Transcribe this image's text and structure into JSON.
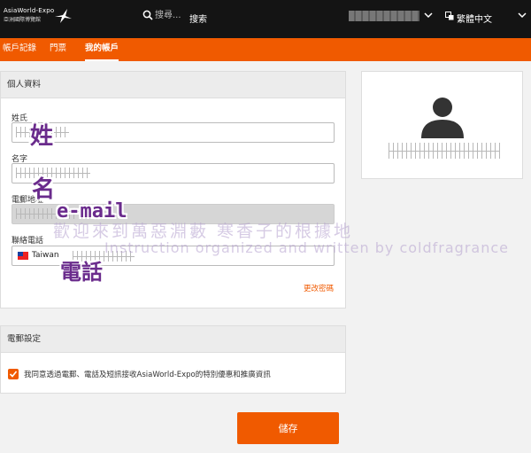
{
  "header": {
    "logo_line1": "AsiaWorld-Expo",
    "logo_line2": "亞洲國際博覽館",
    "search_placeholder": "搜尋...",
    "search_label": "搜索",
    "language_label": "繁體中文"
  },
  "tabs": [
    {
      "label": "帳戶記錄",
      "active": false
    },
    {
      "label": "門票",
      "active": false
    },
    {
      "label": "我的帳戶",
      "active": true
    }
  ],
  "personal": {
    "heading": "個人資料",
    "surname_label": "姓氏",
    "given_name_label": "名字",
    "email_label": "電郵地址",
    "phone_label": "聯絡電話",
    "phone_country": "Taiwan",
    "change_password": "更改密碼"
  },
  "subscription": {
    "heading": "電郵設定",
    "consent_text": "我同意透過電郵、電話及短訊接收AsiaWorld-Expo的特別優惠和推廣資訊",
    "consent_checked": true
  },
  "save_label": "儲存",
  "annotations": {
    "surname": "姓",
    "given_name": "名",
    "email": "e-mail",
    "phone": "電話"
  },
  "watermark": {
    "line1": "歡迎來到萬惡淵藪 寒香子的根據地",
    "line2": "Instruction organized and written by coldfragrance"
  },
  "colors": {
    "accent": "#f05a00",
    "header_bg": "#141414",
    "annotation": "#6a2b8c"
  }
}
